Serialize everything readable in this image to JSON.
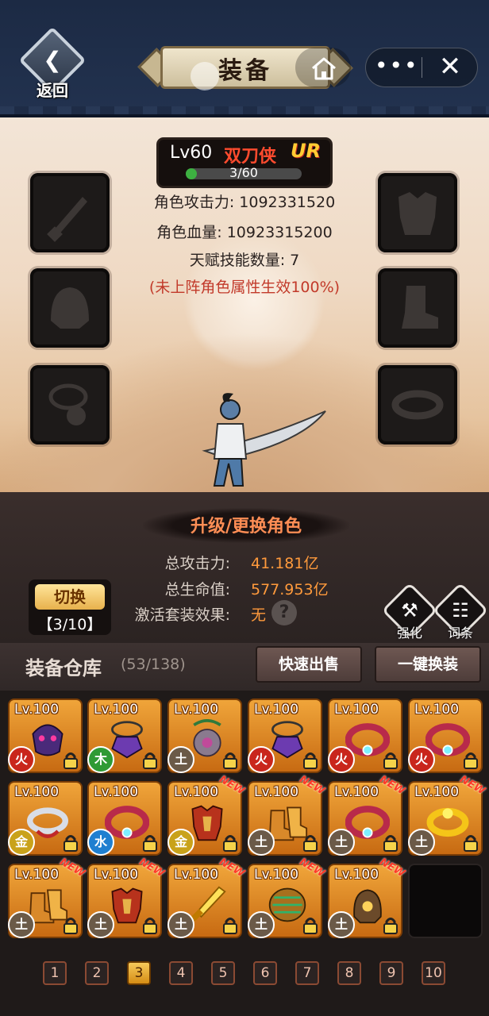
{
  "header": {
    "back_label": "返回",
    "title": "装备"
  },
  "character": {
    "level": "Lv60",
    "name": "双刀侠",
    "rank": "UR",
    "xp_text": "3/60",
    "xp_fraction": 0.05,
    "attack_line": "角色攻击力: 1092331520",
    "hp_line": "角色血量: 10923315200",
    "talent_line": "天赋技能数量: 7",
    "note_line": "(未上阵角色属性生效100%)"
  },
  "summary": {
    "upgrade_label": "升级/更换角色",
    "total_attack_label": "总攻击力:",
    "total_attack_value": "41.181亿",
    "total_hp_label": "总生命值:",
    "total_hp_value": "577.953亿",
    "set_effect_label": "激活套装效果:",
    "set_effect_value": "无",
    "help_symbol": "?"
  },
  "switch": {
    "label": "切换",
    "count": "【3/10】"
  },
  "tools": {
    "enhance_label": "强化",
    "affix_label": "词条"
  },
  "warehouse": {
    "title": "装备仓库",
    "count": "(53/138)",
    "quick_sell": "快速出售",
    "one_click_equip": "一键换装"
  },
  "items": [
    {
      "level": "Lv.100",
      "element": "火",
      "color": "#c9261c",
      "art": "mask-purple",
      "new": false
    },
    {
      "level": "Lv.100",
      "element": "木",
      "color": "#2f9a35",
      "art": "amulet-purple",
      "new": false
    },
    {
      "level": "Lv.100",
      "element": "土",
      "color": "#6b5a48",
      "art": "pendant-green",
      "new": false
    },
    {
      "level": "Lv.100",
      "element": "火",
      "color": "#c9261c",
      "art": "amulet-purple",
      "new": false
    },
    {
      "level": "Lv.100",
      "element": "火",
      "color": "#c9261c",
      "art": "ring-red",
      "new": false
    },
    {
      "level": "Lv.100",
      "element": "火",
      "color": "#c9261c",
      "art": "ring-red",
      "new": false
    },
    {
      "level": "Lv.100",
      "element": "金",
      "color": "#c9a21a",
      "art": "ring-silver",
      "new": false
    },
    {
      "level": "Lv.100",
      "element": "水",
      "color": "#1f7fd0",
      "art": "ring-red",
      "new": false
    },
    {
      "level": "Lv.100",
      "element": "金",
      "color": "#c9a21a",
      "art": "armor-red",
      "new": true
    },
    {
      "level": "Lv.100",
      "element": "土",
      "color": "#6b5a48",
      "art": "boots-gold",
      "new": true
    },
    {
      "level": "Lv.100",
      "element": "土",
      "color": "#6b5a48",
      "art": "ring-red",
      "new": true
    },
    {
      "level": "Lv.100",
      "element": "土",
      "color": "#6b5a48",
      "art": "ring-gold",
      "new": true
    },
    {
      "level": "Lv.100",
      "element": "土",
      "color": "#6b5a48",
      "art": "boots-gold",
      "new": true
    },
    {
      "level": "Lv.100",
      "element": "土",
      "color": "#6b5a48",
      "art": "armor-red",
      "new": true
    },
    {
      "level": "Lv.100",
      "element": "土",
      "color": "#6b5a48",
      "art": "sword-gold",
      "new": true
    },
    {
      "level": "Lv.100",
      "element": "土",
      "color": "#6b5a48",
      "art": "belt-gold",
      "new": true
    },
    {
      "level": "Lv.100",
      "element": "土",
      "color": "#6b5a48",
      "art": "helmet-bronze",
      "new": true
    }
  ],
  "new_label": "NEW",
  "pages": [
    "1",
    "2",
    "3",
    "4",
    "5",
    "6",
    "7",
    "8",
    "9",
    "10"
  ],
  "current_page": 3
}
